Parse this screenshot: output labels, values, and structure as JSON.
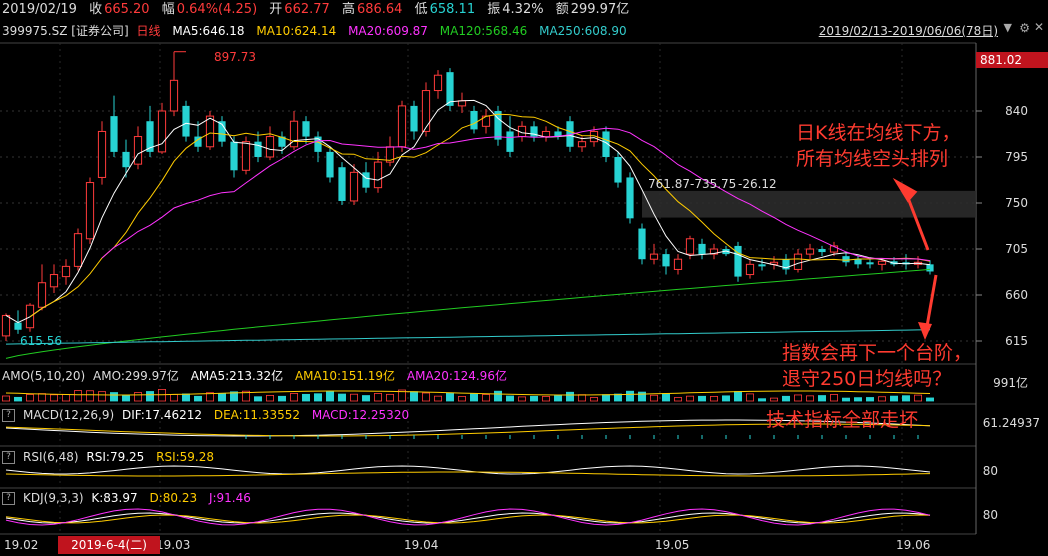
{
  "header": {
    "date": "2019/02/19",
    "close_label": "收",
    "close": "665.20",
    "change_label": "幅",
    "change": "0.64%(4.25)",
    "open_label": "开",
    "open": "662.77",
    "high_label": "高",
    "high": "686.64",
    "low_label": "低",
    "low": "658.11",
    "amp_label": "振",
    "amp": "4.32%",
    "amount_label": "额",
    "amount": "299.97亿"
  },
  "legend": {
    "code": "399975.SZ [证券公司]",
    "period": "日线",
    "ma5": "MA5:646.18",
    "ma10": "MA10:624.14",
    "ma20": "MA20:609.87",
    "ma120": "MA120:568.46",
    "ma250": "MA250:608.90",
    "range": "2019/02/13-2019/06/06(78日)"
  },
  "colors": {
    "up": "#ff3b3b",
    "down": "#27d3d3",
    "ma5": "#ffffff",
    "ma10": "#ffcc00",
    "ma20": "#ff33ff",
    "ma120": "#22cc22",
    "ma250": "#33cccc",
    "annotation": "#ff3b30"
  },
  "price_axis": {
    "ticks": [
      "840",
      "795",
      "750",
      "705",
      "660",
      "615"
    ],
    "current": "881.02"
  },
  "markers": {
    "high": "897.73",
    "low": "615.56",
    "range_box": "761.87-735.75",
    "range_diff": "-26.12"
  },
  "amo": {
    "label": "AMO(5,10,20)",
    "amo": "AMO:299.97亿",
    "ama5": "AMA5:213.32亿",
    "ama10": "AMA10:151.19亿",
    "ama20": "AMA20:124.96亿",
    "axis": "991亿"
  },
  "macd": {
    "label": "MACD(12,26,9)",
    "dif": "DIF:17.46212",
    "dea": "DEA:11.33552",
    "macd": "MACD:12.25320",
    "axis": "61.24937"
  },
  "rsi": {
    "label": "RSI(6,48)",
    "rsi1": "RSI:79.25",
    "rsi2": "RSI:59.28",
    "axis": "80"
  },
  "kdj": {
    "label": "KDJ(9,3,3)",
    "k": "K:83.97",
    "d": "D:80.23",
    "j": "J:91.46",
    "axis": "80"
  },
  "time_axis": {
    "labels": [
      "19.02",
      "19.03",
      "19.04",
      "19.05",
      "19.06"
    ],
    "cursor_date": "2019-6-4(二)"
  },
  "annotations": {
    "a1_line1": "日K线在均线下方，",
    "a1_line2": "所有均线空头排列",
    "a2_line1": "指数会再下一个台阶，",
    "a2_line2": "退守250日均线吗？",
    "a3": "技术指标全部走坏"
  },
  "chart_data": {
    "type": "candlestick",
    "title": "399975.SZ [证券公司] 日线",
    "ylim": [
      600,
      900
    ],
    "candles": [
      {
        "o": 620,
        "c": 640,
        "h": 642,
        "l": 615
      },
      {
        "o": 633,
        "c": 626,
        "h": 645,
        "l": 622
      },
      {
        "o": 628,
        "c": 650,
        "h": 652,
        "l": 624
      },
      {
        "o": 648,
        "c": 672,
        "h": 690,
        "l": 645
      },
      {
        "o": 668,
        "c": 680,
        "h": 690,
        "l": 662
      },
      {
        "o": 678,
        "c": 688,
        "h": 695,
        "l": 670
      },
      {
        "o": 688,
        "c": 720,
        "h": 725,
        "l": 684
      },
      {
        "o": 715,
        "c": 770,
        "h": 775,
        "l": 710
      },
      {
        "o": 775,
        "c": 820,
        "h": 830,
        "l": 768
      },
      {
        "o": 835,
        "c": 800,
        "h": 855,
        "l": 795
      },
      {
        "o": 800,
        "c": 785,
        "h": 812,
        "l": 775
      },
      {
        "o": 788,
        "c": 815,
        "h": 825,
        "l": 783
      },
      {
        "o": 830,
        "c": 800,
        "h": 845,
        "l": 795
      },
      {
        "o": 800,
        "c": 840,
        "h": 848,
        "l": 798
      },
      {
        "o": 840,
        "c": 870,
        "h": 898,
        "l": 835
      },
      {
        "o": 845,
        "c": 815,
        "h": 850,
        "l": 810
      },
      {
        "o": 815,
        "c": 805,
        "h": 830,
        "l": 800
      },
      {
        "o": 805,
        "c": 835,
        "h": 840,
        "l": 802
      },
      {
        "o": 830,
        "c": 810,
        "h": 835,
        "l": 805
      },
      {
        "o": 810,
        "c": 782,
        "h": 815,
        "l": 775
      },
      {
        "o": 782,
        "c": 810,
        "h": 815,
        "l": 778
      },
      {
        "o": 810,
        "c": 795,
        "h": 820,
        "l": 790
      },
      {
        "o": 795,
        "c": 815,
        "h": 825,
        "l": 792
      },
      {
        "o": 815,
        "c": 805,
        "h": 820,
        "l": 798
      },
      {
        "o": 805,
        "c": 830,
        "h": 840,
        "l": 802
      },
      {
        "o": 830,
        "c": 815,
        "h": 835,
        "l": 808
      },
      {
        "o": 815,
        "c": 800,
        "h": 820,
        "l": 790
      },
      {
        "o": 800,
        "c": 775,
        "h": 805,
        "l": 770
      },
      {
        "o": 785,
        "c": 752,
        "h": 790,
        "l": 748
      },
      {
        "o": 752,
        "c": 780,
        "h": 788,
        "l": 748
      },
      {
        "o": 780,
        "c": 765,
        "h": 790,
        "l": 760
      },
      {
        "o": 765,
        "c": 790,
        "h": 800,
        "l": 760
      },
      {
        "o": 790,
        "c": 805,
        "h": 815,
        "l": 786
      },
      {
        "o": 805,
        "c": 845,
        "h": 850,
        "l": 800
      },
      {
        "o": 845,
        "c": 820,
        "h": 850,
        "l": 812
      },
      {
        "o": 820,
        "c": 860,
        "h": 868,
        "l": 815
      },
      {
        "o": 860,
        "c": 875,
        "h": 880,
        "l": 852
      },
      {
        "o": 878,
        "c": 845,
        "h": 882,
        "l": 840
      },
      {
        "o": 845,
        "c": 850,
        "h": 858,
        "l": 838
      },
      {
        "o": 840,
        "c": 822,
        "h": 845,
        "l": 818
      },
      {
        "o": 825,
        "c": 835,
        "h": 842,
        "l": 818
      },
      {
        "o": 840,
        "c": 812,
        "h": 845,
        "l": 806
      },
      {
        "o": 820,
        "c": 800,
        "h": 835,
        "l": 795
      },
      {
        "o": 815,
        "c": 825,
        "h": 830,
        "l": 810
      },
      {
        "o": 825,
        "c": 815,
        "h": 830,
        "l": 810
      },
      {
        "o": 815,
        "c": 820,
        "h": 825,
        "l": 810
      },
      {
        "o": 820,
        "c": 815,
        "h": 825,
        "l": 812
      },
      {
        "o": 830,
        "c": 805,
        "h": 835,
        "l": 800
      },
      {
        "o": 805,
        "c": 810,
        "h": 815,
        "l": 800
      },
      {
        "o": 810,
        "c": 820,
        "h": 825,
        "l": 805
      },
      {
        "o": 820,
        "c": 795,
        "h": 825,
        "l": 790
      },
      {
        "o": 795,
        "c": 770,
        "h": 800,
        "l": 765
      },
      {
        "o": 775,
        "c": 735,
        "h": 780,
        "l": 730
      },
      {
        "o": 725,
        "c": 695,
        "h": 730,
        "l": 690
      },
      {
        "o": 695,
        "c": 700,
        "h": 710,
        "l": 690
      },
      {
        "o": 700,
        "c": 688,
        "h": 705,
        "l": 680
      },
      {
        "o": 685,
        "c": 695,
        "h": 700,
        "l": 680
      },
      {
        "o": 700,
        "c": 715,
        "h": 718,
        "l": 695
      },
      {
        "o": 710,
        "c": 700,
        "h": 715,
        "l": 695
      },
      {
        "o": 700,
        "c": 705,
        "h": 710,
        "l": 695
      },
      {
        "o": 705,
        "c": 700,
        "h": 708,
        "l": 698
      },
      {
        "o": 708,
        "c": 678,
        "h": 712,
        "l": 673
      },
      {
        "o": 680,
        "c": 690,
        "h": 695,
        "l": 676
      },
      {
        "o": 690,
        "c": 688,
        "h": 695,
        "l": 684
      },
      {
        "o": 690,
        "c": 692,
        "h": 698,
        "l": 685
      },
      {
        "o": 695,
        "c": 685,
        "h": 700,
        "l": 680
      },
      {
        "o": 685,
        "c": 700,
        "h": 705,
        "l": 682
      },
      {
        "o": 700,
        "c": 705,
        "h": 710,
        "l": 695
      },
      {
        "o": 705,
        "c": 702,
        "h": 708,
        "l": 698
      },
      {
        "o": 702,
        "c": 708,
        "h": 712,
        "l": 698
      },
      {
        "o": 698,
        "c": 692,
        "h": 702,
        "l": 688
      },
      {
        "o": 695,
        "c": 690,
        "h": 698,
        "l": 686
      },
      {
        "o": 692,
        "c": 690,
        "h": 696,
        "l": 686
      },
      {
        "o": 690,
        "c": 693,
        "h": 696,
        "l": 684
      },
      {
        "o": 693,
        "c": 690,
        "h": 697,
        "l": 688
      },
      {
        "o": 692,
        "c": 690,
        "h": 700,
        "l": 685
      },
      {
        "o": 690,
        "c": 692,
        "h": 698,
        "l": 686
      },
      {
        "o": 690,
        "c": 683,
        "h": 694,
        "l": 680
      }
    ]
  }
}
